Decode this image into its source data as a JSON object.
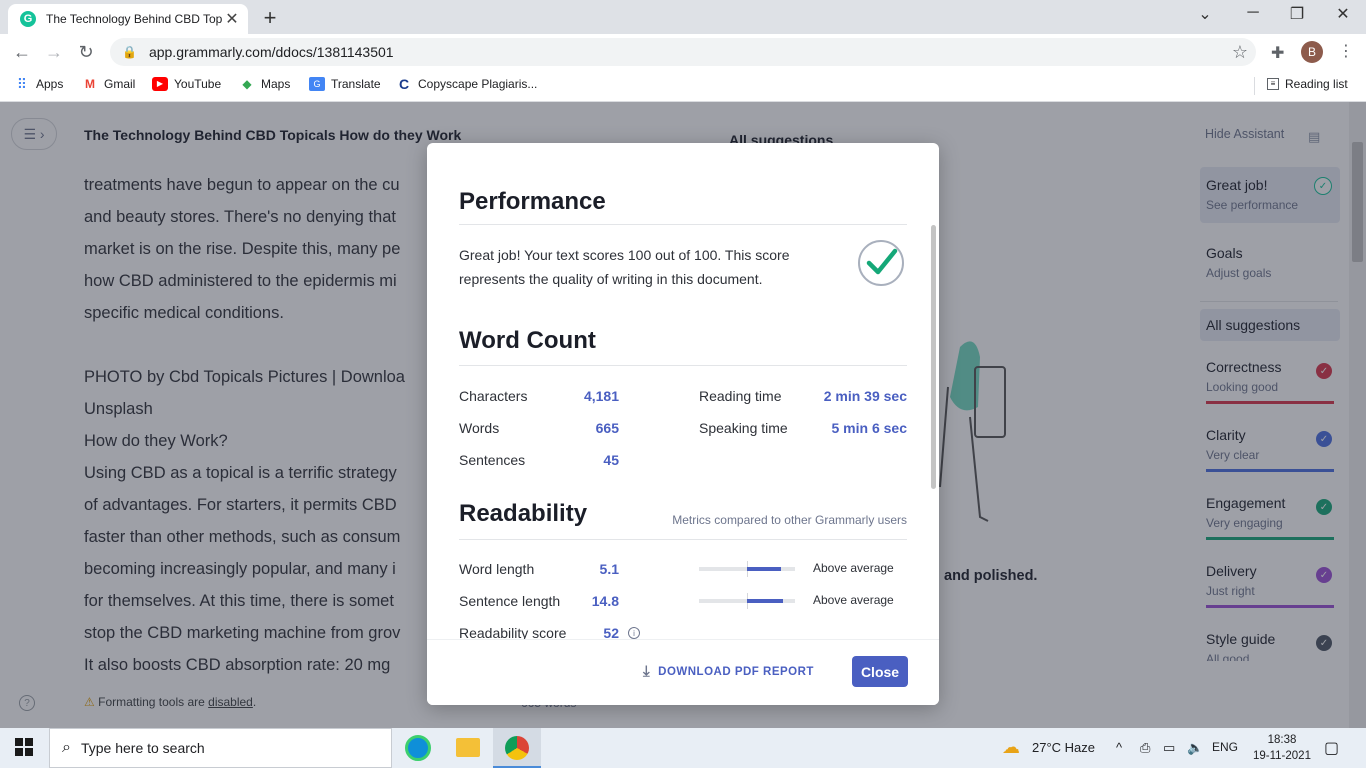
{
  "browser": {
    "tab_title": "The Technology Behind CBD Topic",
    "url": "app.grammarly.com/ddocs/1381143501",
    "profile_initial": "B",
    "bookmarks": [
      "Apps",
      "Gmail",
      "YouTube",
      "Maps",
      "Translate",
      "Copyscape Plagiaris..."
    ],
    "reading_list": "Reading list"
  },
  "editor": {
    "doc_title": "The Technology Behind CBD Topicals How do they Work",
    "lines": [
      "treatments have begun to appear on the cu",
      "and beauty stores. There's no denying that",
      "market is on the rise. Despite this, many pe",
      "how CBD administered to the epidermis mi",
      "specific medical conditions.",
      "",
      "PHOTO by Cbd Topicals Pictures | Downloa",
      "Unsplash",
      "How do they Work?",
      "Using CBD as a topical is a terrific strategy",
      "of advantages. For starters, it permits CBD",
      "faster than other methods, such as consum",
      "becoming increasingly popular, and many i",
      "for themselves. At this time, there is somet",
      "stop the CBD marketing machine from grov",
      "It also boosts CBD absorption rate: 20 mg"
    ],
    "formatting_note": "Formatting tools are disabled.",
    "formatting_link": "disabled",
    "word_count_hint": "665 words",
    "panel_heading": "All suggestions",
    "panel_tagline": "and polished."
  },
  "sidebar": {
    "hide_label": "Hide Assistant",
    "items": [
      {
        "title": "Great job!",
        "sub": "See performance",
        "color": "#15c39a"
      },
      {
        "title": "Goals",
        "sub": "Adjust goals"
      },
      {
        "title": "All suggestions"
      },
      {
        "title": "Correctness",
        "sub": "Looking good",
        "color": "#d9334a"
      },
      {
        "title": "Clarity",
        "sub": "Very clear",
        "color": "#4a6ee0"
      },
      {
        "title": "Engagement",
        "sub": "Very engaging",
        "color": "#15a878"
      },
      {
        "title": "Delivery",
        "sub": "Just right",
        "color": "#9b4fd6"
      },
      {
        "title": "Style guide",
        "sub": "All good",
        "color": "#4b5563"
      }
    ]
  },
  "modal": {
    "performance_title": "Performance",
    "performance_text_1": "Great job! Your text scores 100 out of 100. This score",
    "performance_text_2": "represents the quality of writing in this document.",
    "score": 100,
    "word_count_title": "Word Count",
    "stats_left": [
      {
        "label": "Characters",
        "value": "4,181"
      },
      {
        "label": "Words",
        "value": "665"
      },
      {
        "label": "Sentences",
        "value": "45"
      }
    ],
    "stats_right": [
      {
        "label": "Reading time",
        "value": "2 min 39 sec"
      },
      {
        "label": "Speaking time",
        "value": "5 min 6 sec"
      }
    ],
    "readability_title": "Readability",
    "readability_note": "Metrics compared to other Grammarly users",
    "readability": [
      {
        "label": "Word length",
        "value": "5.1",
        "comparison": "Above average"
      },
      {
        "label": "Sentence length",
        "value": "14.8",
        "comparison": "Above average"
      },
      {
        "label": "Readability score",
        "value": "52"
      }
    ],
    "download_label": "DOWNLOAD PDF REPORT",
    "close_label": "Close"
  },
  "taskbar": {
    "search_placeholder": "Type here to search",
    "weather": "27°C  Haze",
    "language": "ENG",
    "time": "18:38",
    "date": "19-11-2021"
  }
}
